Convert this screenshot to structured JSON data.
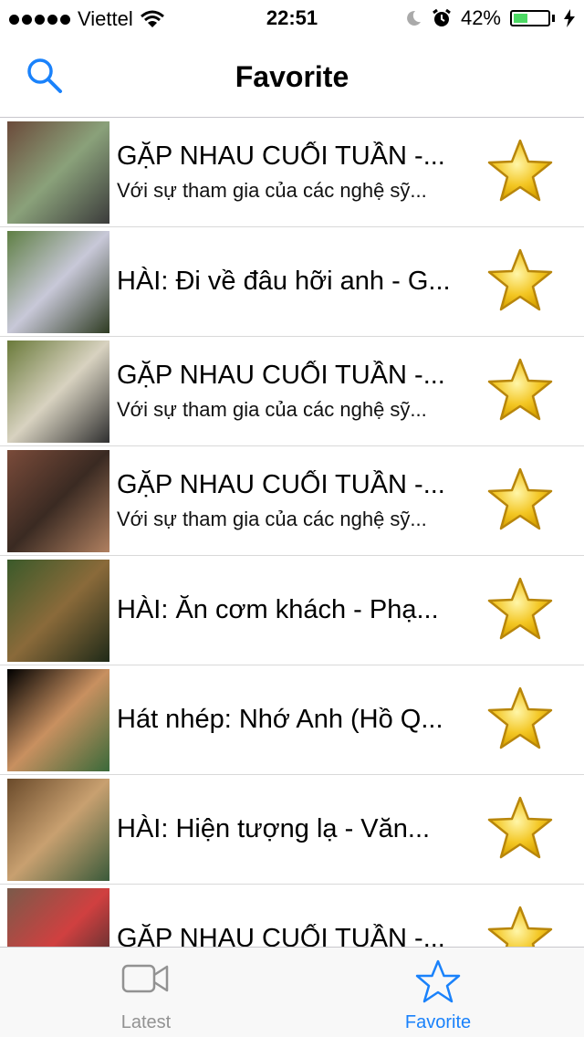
{
  "status": {
    "carrier": "Viettel",
    "time": "22:51",
    "battery": "42%",
    "battery_level": 0.42,
    "icons": [
      "signal-dots-icon",
      "wifi-icon",
      "moon-icon",
      "alarm-icon",
      "battery-icon",
      "charging-bolt-icon"
    ]
  },
  "nav": {
    "title": "Favorite",
    "search_icon": "search-icon"
  },
  "colors": {
    "accent": "#1a82fb",
    "star_fill": "#f3c623",
    "star_stroke": "#b8860b",
    "separator": "#d9d9d9"
  },
  "items": [
    {
      "title": "GẶP NHAU CUỐI TUẦN -...",
      "subtitle": "Với sự tham gia của các nghệ sỹ...",
      "thumb": [
        "#6b4a3a",
        "#8aa17a",
        "#3b3b3b"
      ]
    },
    {
      "title": "HÀI: Đi về đâu hỡi anh - G...",
      "subtitle": "",
      "thumb": [
        "#5f7f44",
        "#c8c8d8",
        "#2e3b22"
      ]
    },
    {
      "title": "GẶP NHAU CUỐI TUẦN -...",
      "subtitle": "Với sự tham gia của các nghệ sỹ...",
      "thumb": [
        "#6a7a3a",
        "#d8d2c0",
        "#2f2f2f"
      ]
    },
    {
      "title": "GẶP NHAU CUỐI TUẦN -...",
      "subtitle": "Với sự tham gia của các nghệ sỹ...",
      "thumb": [
        "#7a4b3a",
        "#3a2a22",
        "#b08060"
      ]
    },
    {
      "title": "HÀI: Ăn cơm khách - Phạ...",
      "subtitle": "",
      "thumb": [
        "#3a5a2a",
        "#8a6a3a",
        "#1f2a18"
      ]
    },
    {
      "title": "Hát nhép: Nhớ Anh (Hồ Q...",
      "subtitle": "",
      "thumb": [
        "#000000",
        "#c89060",
        "#3a6a3a"
      ]
    },
    {
      "title": "HÀI: Hiện tượng lạ  - Văn...",
      "subtitle": "",
      "thumb": [
        "#6a4a2a",
        "#c8a070",
        "#3a5a3a"
      ]
    },
    {
      "title": "GẶP NHAU CUỐI TUẦN -...",
      "subtitle": "",
      "thumb": [
        "#7a5a4a",
        "#d04040",
        "#2a2a2a"
      ]
    }
  ],
  "tabs": [
    {
      "label": "Latest",
      "icon": "video-camera-icon",
      "active": false
    },
    {
      "label": "Favorite",
      "icon": "star-outline-icon",
      "active": true
    }
  ]
}
